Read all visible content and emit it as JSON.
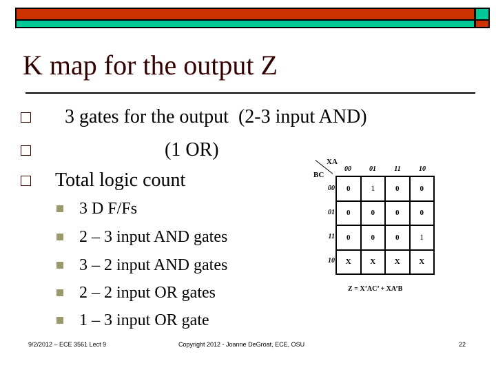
{
  "slide": {
    "title": "K map for the output Z",
    "bullets": [
      {
        "text": "  3 gates for the output  (2-3 input AND)",
        "icon": "hollow-square-bullet-icon"
      },
      {
        "text": "                 (1 OR)",
        "icon": "hollow-square-bullet-icon"
      },
      {
        "text": "Total logic count",
        "icon": "hollow-square-bullet-icon"
      }
    ],
    "sub_bullets": [
      {
        "text": "3 D F/Fs",
        "icon": "filled-square-bullet-icon"
      },
      {
        "text": "2 – 3 input AND gates",
        "icon": "filled-square-bullet-icon"
      },
      {
        "text": "3 – 2 input AND gates",
        "icon": "filled-square-bullet-icon"
      },
      {
        "text": "2 – 2 input OR gates",
        "icon": "filled-square-bullet-icon"
      },
      {
        "text": "1 – 3 input OR gate",
        "icon": "filled-square-bullet-icon"
      }
    ]
  },
  "kmap": {
    "col_var": "XA",
    "row_var": "BC",
    "col_headers": [
      "00",
      "01",
      "11",
      "10"
    ],
    "row_headers": [
      "00",
      "01",
      "11",
      "10"
    ],
    "cells": [
      [
        "0",
        "1",
        "0",
        "0"
      ],
      [
        "0",
        "0",
        "0",
        "0"
      ],
      [
        "0",
        "0",
        "0",
        "1"
      ],
      [
        "X",
        "X",
        "X",
        "X"
      ]
    ],
    "equation": "Z = X’AC’ + XA’B"
  },
  "footer": {
    "left": "9/2/2012 – ECE 3561 Lect 9",
    "center": "Copyright 2012 - Joanne DeGroat, ECE, OSU",
    "page_number": "22"
  },
  "colors": {
    "bar_red": "#cc3300",
    "bar_teal": "#00c896",
    "title_color": "#330000",
    "sub_bullet_color": "#99996b"
  }
}
